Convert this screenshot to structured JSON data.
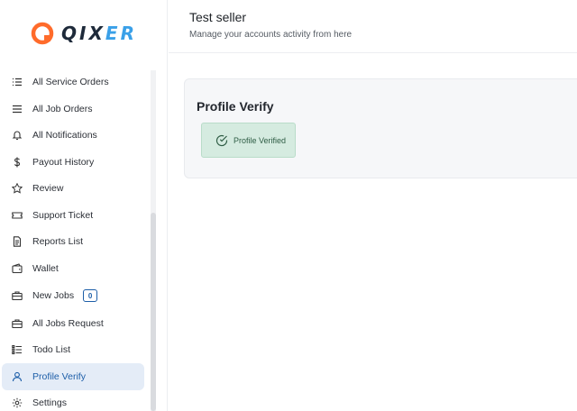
{
  "brand": {
    "name_main": "QIX",
    "name_accent": "ER"
  },
  "header": {
    "title": "Test seller",
    "subtitle": "Manage your accounts activity from here"
  },
  "sidebar": {
    "items": [
      {
        "label": "All Service Orders",
        "icon": "list-check-icon"
      },
      {
        "label": "All Job Orders",
        "icon": "menu-lines-icon"
      },
      {
        "label": "All Notifications",
        "icon": "bell-icon"
      },
      {
        "label": "Payout History",
        "icon": "dollar-icon"
      },
      {
        "label": "Review",
        "icon": "star-icon"
      },
      {
        "label": "Support Ticket",
        "icon": "ticket-icon"
      },
      {
        "label": "Reports List",
        "icon": "document-icon"
      },
      {
        "label": "Wallet",
        "icon": "wallet-icon"
      },
      {
        "label": "New Jobs",
        "icon": "briefcase-icon",
        "badge": "0"
      },
      {
        "label": "All Jobs Request",
        "icon": "briefcase-icon"
      },
      {
        "label": "Todo List",
        "icon": "todo-list-icon"
      },
      {
        "label": "Profile Verify",
        "icon": "user-icon",
        "active": true
      },
      {
        "label": "Settings",
        "icon": "gear-icon"
      }
    ]
  },
  "main": {
    "card_title": "Profile Verify",
    "status": "Profile Verified"
  },
  "colors": {
    "accent": "#1d5ea8",
    "active_bg": "#e4ecf7",
    "success_bg": "#d5ebe0",
    "brand_orange": "#ff6b2b",
    "brand_blue": "#3aa0e8"
  }
}
